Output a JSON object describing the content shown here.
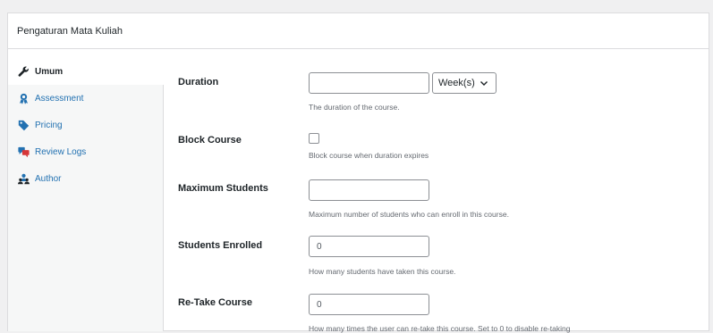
{
  "panel": {
    "title": "Pengaturan Mata Kuliah"
  },
  "sidebar": {
    "items": [
      {
        "label": "Umum",
        "icon": "wrench-icon",
        "active": true
      },
      {
        "label": "Assessment",
        "icon": "award-icon"
      },
      {
        "label": "Pricing",
        "icon": "tag-icon"
      },
      {
        "label": "Review Logs",
        "icon": "chat-icon"
      },
      {
        "label": "Author",
        "icon": "users-icon"
      }
    ]
  },
  "fields": {
    "duration": {
      "label": "Duration",
      "value": "",
      "unit": "Week(s)",
      "description": "The duration of the course."
    },
    "block_course": {
      "label": "Block Course",
      "checked": false,
      "description": "Block course when duration expires"
    },
    "max_students": {
      "label": "Maximum Students",
      "value": "",
      "description": "Maximum number of students who can enroll in this course."
    },
    "students_enrolled": {
      "label": "Students Enrolled",
      "value": "0",
      "description": "How many students have taken this course."
    },
    "retake_course": {
      "label": "Re-Take Course",
      "value": "0",
      "description": "How many times the user can re-take this course. Set to 0 to disable re-taking"
    }
  },
  "colors": {
    "link": "#2271b1",
    "border": "#dcdcde",
    "bg": "#f0f0f1",
    "sidebar_bg": "#f6f7f7"
  }
}
